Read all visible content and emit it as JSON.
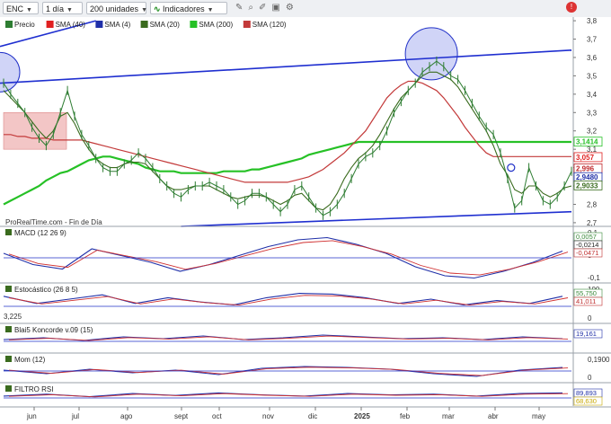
{
  "toolbar": {
    "symbol": "ENC",
    "timeframe": "1 día",
    "units": "200 unidades",
    "indicators_label": "Indicadores"
  },
  "price_panel": {
    "watermark": "ProRealTime.com - Fin de Día",
    "legend": [
      {
        "label": "Precio",
        "color": "#2e7d32"
      },
      {
        "label": "SMA (40)",
        "color": "#e02020"
      },
      {
        "label": "SMA (4)",
        "color": "#1f2fa8"
      },
      {
        "label": "SMA (20)",
        "color": "#3a6b1e"
      },
      {
        "label": "SMA (200)",
        "color": "#26c126"
      },
      {
        "label": "SMA (120)",
        "color": "#c33a3a"
      }
    ],
    "y_ticks": [
      "3,8",
      "3,7",
      "3,6",
      "3,5",
      "3,4",
      "3,3",
      "3,2",
      "3,1",
      "3",
      "2,9",
      "2,8",
      "2,7"
    ],
    "y_tick_values": [
      3.8,
      3.7,
      3.6,
      3.5,
      3.4,
      3.3,
      3.2,
      3.1,
      3.0,
      2.9,
      2.8,
      2.7
    ],
    "value_tags": [
      {
        "text": "3,1414",
        "value": 3.1414,
        "color": "#26c126"
      },
      {
        "text": "3,057",
        "value": 3.057,
        "color": "#e02020"
      },
      {
        "text": "2,996",
        "value": 2.996,
        "color": "#c0282c"
      },
      {
        "text": "2,9480",
        "value": 2.948,
        "color": "#1f2fa8"
      },
      {
        "text": "2,9033",
        "value": 2.9033,
        "color": "#3a6b1e"
      }
    ]
  },
  "sub_panels": [
    {
      "title": "MACD (12 26 9)",
      "ticks": [
        "0,1",
        "0",
        "-0,1"
      ],
      "tags": [
        {
          "text": "0,0057",
          "color": "#3a8a3a"
        },
        {
          "text": "-0,0214",
          "color": "#222"
        },
        {
          "text": "-0,0471",
          "color": "#c03030"
        }
      ]
    },
    {
      "title": "Estocástico (26 8 5)",
      "ticks": [
        "100",
        "0"
      ],
      "tags": [
        {
          "text": "55,750",
          "color": "#3a8a3a"
        },
        {
          "text": "41,011",
          "color": "#c03030"
        }
      ],
      "left_value": "3,225"
    },
    {
      "title": "Blai5 Koncorde v.09 (15)",
      "ticks": [],
      "tags": [
        {
          "text": "19,161",
          "color": "#1f2fa8"
        }
      ]
    },
    {
      "title": "Mom (12)",
      "ticks": [
        "0,1900",
        "0"
      ],
      "tags": []
    },
    {
      "title": "FILTRO RSI",
      "ticks": [],
      "tags": [
        {
          "text": "89,893",
          "color": "#1f2fa8"
        },
        {
          "text": "68,630",
          "color": "#c8a800"
        }
      ]
    }
  ],
  "chart_data": {
    "type": "line",
    "x_tick_labels": [
      "jun",
      "jul",
      "ago",
      "sept",
      "oct",
      "nov",
      "dic",
      "2025",
      "feb",
      "mar",
      "abr",
      "may"
    ],
    "ylim": [
      2.68,
      3.82
    ],
    "series": [
      {
        "name": "Precio",
        "color": "#2e7d32",
        "values": [
          3.46,
          3.4,
          3.35,
          3.3,
          3.22,
          3.16,
          3.12,
          3.18,
          3.3,
          3.42,
          3.28,
          3.18,
          3.12,
          3.05,
          3.0,
          2.98,
          2.98,
          3.02,
          3.04,
          3.08,
          3.05,
          3.0,
          2.94,
          2.9,
          2.86,
          2.84,
          2.88,
          2.9,
          2.9,
          2.92,
          2.9,
          2.88,
          2.84,
          2.8,
          2.82,
          2.86,
          2.86,
          2.84,
          2.8,
          2.76,
          2.8,
          2.88,
          2.9,
          2.84,
          2.78,
          2.74,
          2.76,
          2.8,
          2.86,
          2.94,
          3.02,
          3.06,
          3.08,
          3.12,
          3.2,
          3.3,
          3.36,
          3.42,
          3.46,
          3.52,
          3.55,
          3.58,
          3.55,
          3.5,
          3.48,
          3.42,
          3.35,
          3.28,
          3.22,
          3.18,
          3.08,
          2.94,
          2.78,
          2.82,
          3.0,
          2.9,
          2.82,
          2.8,
          2.84,
          2.9,
          2.98
        ]
      },
      {
        "name": "SMA (200)",
        "color": "#26c126",
        "values": [
          2.8,
          2.82,
          2.84,
          2.86,
          2.88,
          2.9,
          2.93,
          2.95,
          2.97,
          2.98,
          3.0,
          3.02,
          3.04,
          3.05,
          3.06,
          3.06,
          3.05,
          3.04,
          3.03,
          3.02,
          3.0,
          2.99,
          2.98,
          2.98,
          2.98,
          2.97,
          2.97,
          2.97,
          2.97,
          2.97,
          2.97,
          2.98,
          2.98,
          2.98,
          2.98,
          2.99,
          2.99,
          3.0,
          3.01,
          3.02,
          3.03,
          3.04,
          3.05,
          3.07,
          3.08,
          3.09,
          3.1,
          3.11,
          3.12,
          3.13,
          3.14,
          3.14,
          3.14,
          3.14,
          3.14,
          3.14,
          3.14,
          3.14,
          3.14,
          3.14,
          3.14,
          3.14,
          3.14,
          3.14,
          3.14,
          3.14,
          3.14,
          3.14,
          3.14,
          3.14,
          3.14,
          3.14,
          3.14,
          3.14,
          3.14,
          3.14,
          3.14,
          3.14,
          3.14,
          3.14,
          3.14
        ]
      },
      {
        "name": "SMA (120)",
        "color": "#c33a3a",
        "values": [
          3.18,
          3.18,
          3.17,
          3.17,
          3.16,
          3.16,
          3.16,
          3.15,
          3.15,
          3.15,
          3.15,
          3.15,
          3.14,
          3.13,
          3.12,
          3.11,
          3.1,
          3.09,
          3.08,
          3.07,
          3.06,
          3.05,
          3.04,
          3.03,
          3.02,
          3.01,
          3.0,
          2.99,
          2.98,
          2.97,
          2.96,
          2.95,
          2.94,
          2.93,
          2.92,
          2.92,
          2.92,
          2.92,
          2.92,
          2.92,
          2.92,
          2.93,
          2.94,
          2.95,
          2.97,
          2.99,
          3.02,
          3.05,
          3.08,
          3.12,
          3.16,
          3.2,
          3.26,
          3.32,
          3.38,
          3.42,
          3.45,
          3.47,
          3.47,
          3.46,
          3.44,
          3.42,
          3.38,
          3.33,
          3.28,
          3.22,
          3.17,
          3.12,
          3.08,
          3.06,
          3.06,
          3.06,
          3.06,
          3.06,
          3.06,
          3.06,
          3.06,
          3.06,
          3.06,
          3.06,
          3.06
        ]
      },
      {
        "name": "SMA (20)",
        "color": "#3a6b1e",
        "values": [
          3.42,
          3.38,
          3.34,
          3.3,
          3.25,
          3.2,
          3.16,
          3.2,
          3.28,
          3.3,
          3.24,
          3.16,
          3.1,
          3.05,
          3.02,
          3.0,
          3.0,
          3.02,
          3.03,
          3.03,
          3.02,
          2.98,
          2.94,
          2.9,
          2.88,
          2.88,
          2.89,
          2.9,
          2.9,
          2.9,
          2.88,
          2.86,
          2.84,
          2.83,
          2.84,
          2.85,
          2.85,
          2.84,
          2.82,
          2.8,
          2.82,
          2.85,
          2.86,
          2.82,
          2.78,
          2.77,
          2.8,
          2.86,
          2.94,
          3.0,
          3.05,
          3.08,
          3.12,
          3.18,
          3.25,
          3.32,
          3.38,
          3.42,
          3.46,
          3.5,
          3.52,
          3.52,
          3.5,
          3.48,
          3.44,
          3.38,
          3.32,
          3.26,
          3.2,
          3.12,
          3.02,
          2.96,
          2.88,
          2.86,
          2.9,
          2.9,
          2.86,
          2.84,
          2.86,
          2.89,
          2.9
        ]
      }
    ]
  }
}
